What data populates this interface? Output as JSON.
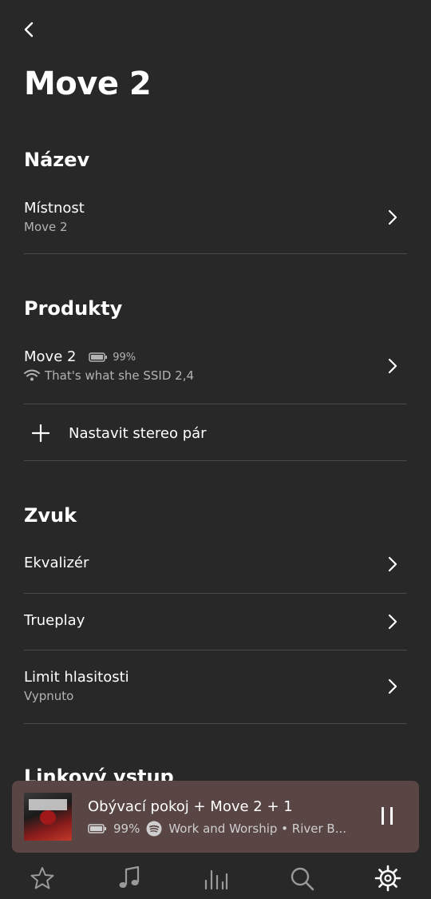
{
  "page": {
    "title": "Move 2"
  },
  "sections": {
    "name": {
      "title": "Název",
      "rows": [
        {
          "label": "Místnost",
          "value": "Move 2"
        }
      ]
    },
    "products": {
      "title": "Produkty",
      "device": {
        "label": "Move 2",
        "battery": "99%",
        "network": "That's what she SSID 2,4"
      },
      "stereo_pair": "Nastavit stereo pár"
    },
    "sound": {
      "title": "Zvuk",
      "rows": [
        {
          "label": "Ekvalizér"
        },
        {
          "label": "Trueplay"
        },
        {
          "label": "Limit hlasitosti",
          "value": "Vypnuto"
        }
      ]
    },
    "line_in": {
      "title": "Linkový vstup"
    }
  },
  "mini_player": {
    "title": "Obývací pokoj + Move 2 + 1",
    "battery": "99%",
    "track": "Work and Worship • River B..."
  },
  "tabs": [
    {
      "icon": "star-icon"
    },
    {
      "icon": "music-note-icon"
    },
    {
      "icon": "rooms-icon"
    },
    {
      "icon": "search-icon"
    },
    {
      "icon": "gear-icon",
      "active": true
    }
  ],
  "colors": {
    "background": "#282828",
    "player": "#584544",
    "divider": "#4a4a4a",
    "secondary_text": "#b3b3b3"
  }
}
